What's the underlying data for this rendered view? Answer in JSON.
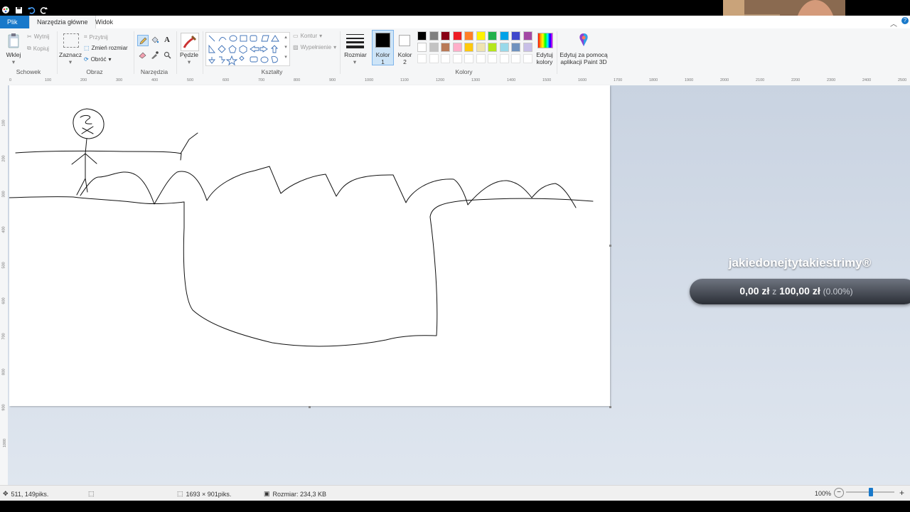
{
  "title_bar": {
    "quick_access": [
      "paint-icon",
      "save-icon",
      "undo-icon",
      "redo-icon"
    ]
  },
  "tabs": {
    "file": "Plik",
    "home": "Narzędzia główne",
    "view": "Widok"
  },
  "ribbon": {
    "clipboard": {
      "paste": "Wklej",
      "cut": "Wytnij",
      "copy": "Kopiuj",
      "group": "Schowek"
    },
    "image": {
      "select": "Zaznacz",
      "crop": "Przytnij",
      "resize": "Zmień rozmiar",
      "rotate": "Obróć",
      "group": "Obraz"
    },
    "tools": {
      "group": "Narzędzia"
    },
    "brushes": {
      "label": "Pędzle"
    },
    "shapes": {
      "outline": "Kontur",
      "fill": "Wypełnienie",
      "group": "Kształty"
    },
    "size": {
      "label": "Rozmiar"
    },
    "color1": {
      "line1": "Kolor",
      "line2": "1"
    },
    "color2": {
      "line1": "Kolor",
      "line2": "2"
    },
    "colors": {
      "group": "Kolory",
      "palette_row1": [
        "#000000",
        "#7f7f7f",
        "#880015",
        "#ed1c24",
        "#ff7f27",
        "#fff200",
        "#22b14c",
        "#00a2e8",
        "#3f48cc",
        "#a349a4"
      ],
      "palette_row2": [
        "#ffffff",
        "#c3c3c3",
        "#b97a57",
        "#ffaec9",
        "#ffc90e",
        "#efe4b0",
        "#b5e61d",
        "#99d9ea",
        "#7092be",
        "#c8bfe7"
      ]
    },
    "edit_colors": {
      "line1": "Edytuj",
      "line2": "kolory"
    },
    "paint3d": {
      "line1": "Edytuj za pomocą",
      "line2": "aplikacji Paint 3D"
    }
  },
  "ruler": {
    "top_ticks": [
      "0",
      "100",
      "200",
      "300",
      "400",
      "500",
      "600",
      "700",
      "800",
      "900",
      "1000",
      "1100",
      "1200",
      "1300",
      "1400",
      "1500",
      "1600",
      "1700",
      "1800",
      "1900",
      "2000",
      "2100",
      "2200",
      "2300",
      "2400",
      "2500"
    ],
    "left_ticks": [
      "100",
      "200",
      "300",
      "400",
      "500",
      "600",
      "700",
      "800",
      "900",
      "1000"
    ]
  },
  "status": {
    "cursor_pos": "511, 149piks.",
    "image_size": "1693 × 901piks.",
    "file_size": "Rozmiar: 234,3 KB",
    "zoom": "100%"
  },
  "overlay": {
    "channel": "jakiedonejtytakiestrimy®",
    "amount": "0,00 zł",
    "of": "z",
    "goal": "100,00 zł",
    "percent": "(0.00%)"
  },
  "colors": {
    "accent": "#1979ca",
    "ribbon_bg": "#f5f6f7",
    "workspace_bg": "#c9d3e1"
  }
}
